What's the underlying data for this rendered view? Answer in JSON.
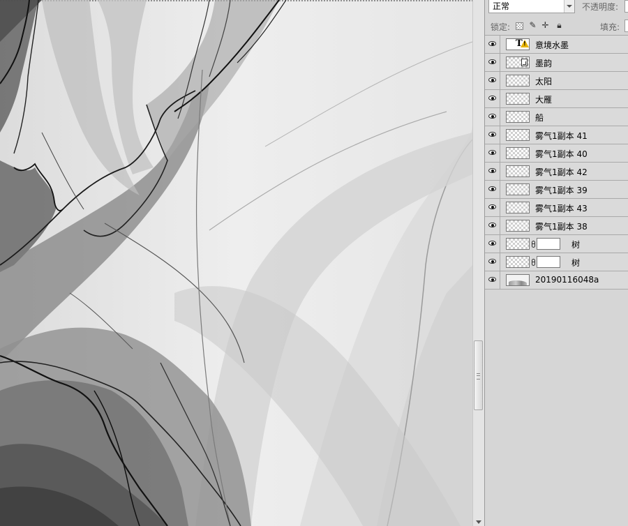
{
  "panel": {
    "blend_mode": "正常",
    "opacity_label": "不透明度:",
    "lock_label": "锁定:",
    "fill_label": "填充:"
  },
  "layers": [
    {
      "name": "意境水墨",
      "kind": "text",
      "has_warning": true
    },
    {
      "name": "墨韵",
      "kind": "smart"
    },
    {
      "name": "太阳",
      "kind": "pixel"
    },
    {
      "name": "大雁",
      "kind": "pixel"
    },
    {
      "name": "船",
      "kind": "pixel"
    },
    {
      "name": "雾气1副本 41",
      "kind": "pixel"
    },
    {
      "name": "雾气1副本 40",
      "kind": "pixel"
    },
    {
      "name": "雾气1副本 42",
      "kind": "pixel"
    },
    {
      "name": "雾气1副本 39",
      "kind": "pixel"
    },
    {
      "name": "雾气1副本 43",
      "kind": "pixel"
    },
    {
      "name": "雾气1副本 38",
      "kind": "pixel"
    },
    {
      "name": "树",
      "kind": "masked"
    },
    {
      "name": "树",
      "kind": "masked"
    },
    {
      "name": "20190116048a",
      "kind": "photo"
    }
  ],
  "colors": {
    "canvas_bg": "#ececec",
    "panel_bg": "#d6d6d6",
    "ink_dark": "#111111"
  }
}
